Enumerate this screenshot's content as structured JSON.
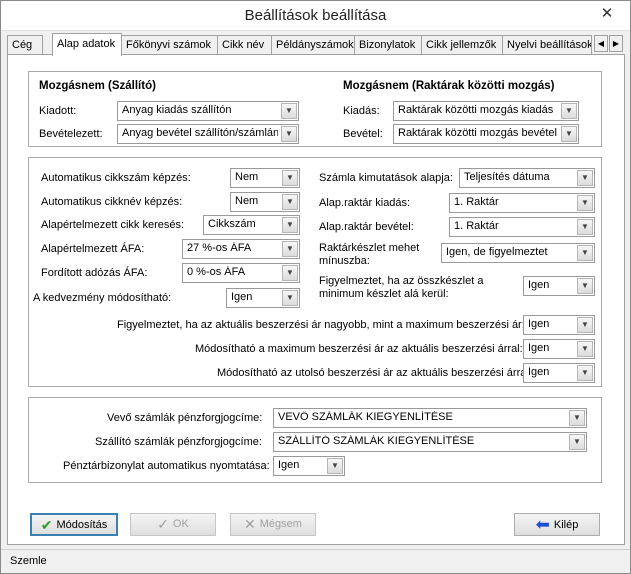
{
  "window": {
    "title": "Beállítások beállítása",
    "close_glyph": "✕"
  },
  "tabs": [
    {
      "label": "Cég"
    },
    {
      "label": "Alap adatok"
    },
    {
      "label": "Főkönyvi számok"
    },
    {
      "label": "Cikk név"
    },
    {
      "label": "Példányszámok"
    },
    {
      "label": "Bizonylatok"
    },
    {
      "label": "Cikk jellemzők"
    },
    {
      "label": "Nyelvi beállítások"
    }
  ],
  "tab_scroll": {
    "left": "◀",
    "right": "▶"
  },
  "supplier": {
    "heading": "Mozgásnem (Szállító)",
    "issue_label": "Kiadott:",
    "issue_value": "Anyag kiadás szállítón",
    "receipt_label": "Bevételezett:",
    "receipt_value": "Anyag bevétel szállítón/számlán"
  },
  "warehouse": {
    "heading": "Mozgásnem (Raktárak közötti mozgás)",
    "issue_label": "Kiadás:",
    "issue_value": "Raktárak közötti mozgás kiadás",
    "receipt_label": "Bevétel:",
    "receipt_value": "Raktárak közötti mozgás bevétel"
  },
  "settings": {
    "auto_item_number_label": "Automatikus cikkszám képzés:",
    "auto_item_number_value": "Nem",
    "auto_item_name_label": "Automatikus cikknév képzés:",
    "auto_item_name_value": "Nem",
    "default_item_search_label": "Alapértelmezett cikk keresés:",
    "default_item_search_value": "Cikkszám",
    "default_vat_label": "Alapértelmezett ÁFA:",
    "default_vat_value": "27 %-os ÁFA",
    "reverse_vat_label": "Fordított adózás ÁFA:",
    "reverse_vat_value": "0 %-os ÁFA",
    "discount_editable_label": "A kedvezmény módosítható:",
    "discount_editable_value": "Igen",
    "invoice_report_basis_label": "Számla kimutatások alapja:",
    "invoice_report_basis_value": "Teljesítés dátuma",
    "default_issue_warehouse_label": "Alap.raktár kiadás:",
    "default_issue_warehouse_value": "1. Raktár",
    "default_receipt_warehouse_label": "Alap.raktár bevétel:",
    "default_receipt_warehouse_value": "1. Raktár",
    "stock_negative_label_1": "Raktárkészlet mehet",
    "stock_negative_label_2": "mínuszba:",
    "stock_negative_value": "Igen, de figyelmeztet",
    "min_stock_warning_label_1": "Figyelmeztet, ha az összkészlet a",
    "min_stock_warning_label_2": "minimum készlet alá kerül:",
    "min_stock_warning_value": "Igen",
    "price_above_max_label": "Figyelmeztet, ha az aktuális beszerzési ár nagyobb, mint a maximum beszerzési ár:",
    "price_above_max_value": "Igen",
    "max_price_editable_label": "Módosítható a maximum beszerzési ár az aktuális beszerzési árral:",
    "max_price_editable_value": "Igen",
    "last_price_editable_label": "Módosítható az utolsó beszerzési ár az aktuális beszerzési árral",
    "last_price_editable_value": "Igen"
  },
  "finance": {
    "customer_title_label": "Vevő számlák pénzforgjogcíme:",
    "customer_title_value": "VEVŐ SZÁMLÁK KIEGYENLÍTÉSE",
    "supplier_title_label": "Szállító számlák pénzforgjogcíme:",
    "supplier_title_value": "SZÁLLÍTÓ SZÁMLÁK KIEGYENLÍTÉSE",
    "auto_print_label": "Pénztárbizonylat automatikus nyomtatása:",
    "auto_print_value": "Igen"
  },
  "buttons": {
    "modify": "Módosítás",
    "ok": "OK",
    "cancel": "Mégsem",
    "exit": "Kilép"
  },
  "status": {
    "text": "Szemle"
  },
  "icons": {
    "dropdown": "chevron-down-icon",
    "modify": "check-icon",
    "ok": "check-icon",
    "cancel": "x-icon",
    "exit": "arrow-left-icon"
  },
  "colors": {
    "check_green": "#2e9b2e",
    "exit_arrow_blue": "#1a4fd0",
    "default_button_border": "#3c7fb1"
  }
}
